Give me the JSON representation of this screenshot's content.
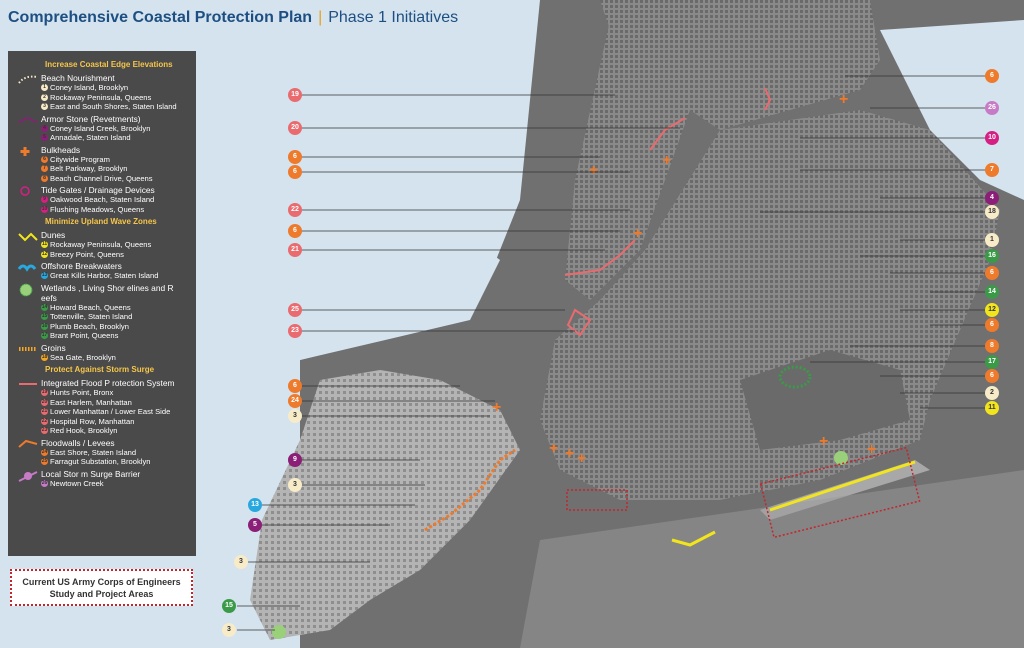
{
  "title": {
    "main": "Comprehensive Coastal Protection Plan",
    "separator": "|",
    "sub": "Phase 1 Initiatives"
  },
  "legend": {
    "sections": [
      {
        "heading": "Increase Coastal Edge Elevations",
        "categories": [
          {
            "name": "Beach Nourishment",
            "symbol": "dotted-line",
            "items": [
              {
                "num": "1",
                "label": "Coney Island, Brooklyn",
                "color": "#f7ebc8"
              },
              {
                "num": "2",
                "label": "Rockaway Peninsula, Queens",
                "color": "#f7ebc8"
              },
              {
                "num": "3",
                "label": "East and South Shores, Staten Island",
                "color": "#f7ebc8"
              }
            ]
          },
          {
            "name": "Armor Stone (Revetments)",
            "symbol": "armor",
            "items": [
              {
                "num": "4",
                "label": "Coney Island Creek, Brooklyn",
                "color": "#8b1f77"
              },
              {
                "num": "5",
                "label": "Annadale, Staten Island",
                "color": "#8b1f77"
              }
            ]
          },
          {
            "name": "Bulkheads",
            "symbol": "plus",
            "items": [
              {
                "num": "6",
                "label": "Citywide Program",
                "color": "#ee7a2c"
              },
              {
                "num": "7",
                "label": "Belt Parkway, Brooklyn",
                "color": "#ee7a2c"
              },
              {
                "num": "8",
                "label": "Beach Channel Drive, Queens",
                "color": "#ee7a2c"
              }
            ]
          },
          {
            "name": "Tide Gates / Drainage Devices",
            "symbol": "ring",
            "items": [
              {
                "num": "9",
                "label": "Oakwood Beach, Staten Island",
                "color": "#d61f83"
              },
              {
                "num": "10",
                "label": "Flushing Meadows, Queens",
                "color": "#d61f83"
              }
            ]
          }
        ]
      },
      {
        "heading": "Minimize Upland Wave Zones",
        "categories": [
          {
            "name": "Dunes",
            "symbol": "zigzag",
            "items": [
              {
                "num": "11",
                "label": "Rockaway Peninsula, Queens",
                "color": "#f2e51b"
              },
              {
                "num": "12",
                "label": "Breezy Point, Queens",
                "color": "#f2e51b"
              }
            ]
          },
          {
            "name": "Offshore Breakwaters",
            "symbol": "breakwater",
            "items": [
              {
                "num": "13",
                "label": "Great Kills Harbor, Staten Island",
                "color": "#27a8df"
              }
            ]
          },
          {
            "name": "Wetlands , Living Shor elines and R eefs",
            "symbol": "wetland",
            "items": [
              {
                "num": "14",
                "label": "Howard Beach, Queens",
                "color": "#3b9a48"
              },
              {
                "num": "15",
                "label": "Tottenville, Staten Island",
                "color": "#3b9a48"
              },
              {
                "num": "16",
                "label": "Plumb Beach, Brooklyn",
                "color": "#3b9a48"
              },
              {
                "num": "17",
                "label": "Brant Point, Queens",
                "color": "#3b9a48"
              }
            ]
          },
          {
            "name": "Groins",
            "symbol": "groin",
            "items": [
              {
                "num": "18",
                "label": "Sea Gate, Brooklyn",
                "color": "#f5a623"
              }
            ]
          }
        ]
      },
      {
        "heading": "Protect Against Storm Surge",
        "categories": [
          {
            "name": "Integrated Flood P rotection System",
            "symbol": "flood-line",
            "items": [
              {
                "num": "19",
                "label": "Hunts Point, Bronx",
                "color": "#ea6b6f"
              },
              {
                "num": "20",
                "label": "East Harlem, Manhattan",
                "color": "#ea6b6f"
              },
              {
                "num": "21",
                "label": "Lower Manhattan / Lower East Side",
                "color": "#ea6b6f"
              },
              {
                "num": "22",
                "label": "Hospital Row, Manhattan",
                "color": "#ea6b6f"
              },
              {
                "num": "23",
                "label": "Red Hook, Brooklyn",
                "color": "#ea6b6f"
              }
            ]
          },
          {
            "name": "Floodwalls / Levees",
            "symbol": "levee",
            "items": [
              {
                "num": "24",
                "label": "East Shore, Staten Island",
                "color": "#ee7a2c"
              },
              {
                "num": "25",
                "label": "Farragut Substation, Brooklyn",
                "color": "#ee7a2c"
              }
            ]
          },
          {
            "name": "Local Stor m Surge Barrier",
            "symbol": "barrier",
            "items": [
              {
                "num": "26",
                "label": "Newtown Creek",
                "color": "#c77bc6"
              }
            ]
          }
        ]
      }
    ],
    "corps_box": {
      "line1": "Current US  Army Corps of Engineers",
      "line2": "Study and Project Areas"
    }
  },
  "callouts": [
    {
      "num": "19",
      "color": "#ea6b6f"
    },
    {
      "num": "20",
      "color": "#ea6b6f"
    },
    {
      "num": "6",
      "color": "#ee7a2c"
    },
    {
      "num": "6",
      "color": "#ee7a2c"
    },
    {
      "num": "22",
      "color": "#ea6b6f"
    },
    {
      "num": "6",
      "color": "#ee7a2c"
    },
    {
      "num": "21",
      "color": "#ea6b6f"
    },
    {
      "num": "25",
      "color": "#ea6b6f"
    },
    {
      "num": "23",
      "color": "#ea6b6f"
    },
    {
      "num": "6",
      "color": "#ee7a2c"
    },
    {
      "num": "24",
      "color": "#ee7a2c"
    },
    {
      "num": "3",
      "color": "#f7ebc8"
    },
    {
      "num": "9",
      "color": "#8b1f77"
    },
    {
      "num": "3",
      "color": "#f7ebc8"
    },
    {
      "num": "13",
      "color": "#27a8df"
    },
    {
      "num": "5",
      "color": "#8b1f77"
    },
    {
      "num": "3",
      "color": "#f7ebc8"
    },
    {
      "num": "15",
      "color": "#3b9a48"
    },
    {
      "num": "3",
      "color": "#f7ebc8"
    },
    {
      "num": "6",
      "color": "#ee7a2c"
    },
    {
      "num": "26",
      "color": "#c77bc6"
    },
    {
      "num": "10",
      "color": "#d61f83"
    },
    {
      "num": "7",
      "color": "#ee7a2c"
    },
    {
      "num": "4",
      "color": "#8b1f77"
    },
    {
      "num": "18",
      "color": "#f7ebc8"
    },
    {
      "num": "1",
      "color": "#f7ebc8"
    },
    {
      "num": "16",
      "color": "#3b9a48"
    },
    {
      "num": "6",
      "color": "#ee7a2c"
    },
    {
      "num": "14",
      "color": "#3b9a48"
    },
    {
      "num": "12",
      "color": "#f2e51b"
    },
    {
      "num": "6",
      "color": "#ee7a2c"
    },
    {
      "num": "8",
      "color": "#ee7a2c"
    },
    {
      "num": "17",
      "color": "#3b9a48"
    },
    {
      "num": "6",
      "color": "#ee7a2c"
    },
    {
      "num": "2",
      "color": "#f7ebc8"
    },
    {
      "num": "11",
      "color": "#f2e51b"
    }
  ]
}
